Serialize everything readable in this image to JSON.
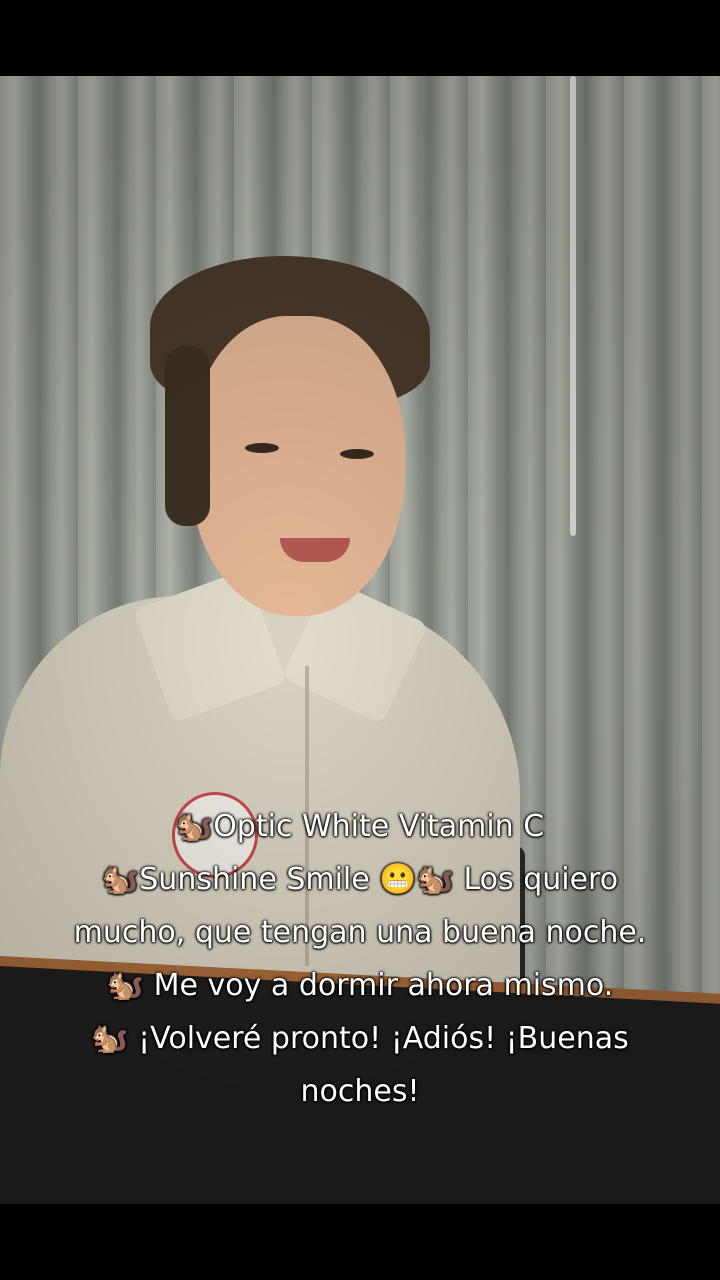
{
  "caption": {
    "lines": [
      "🐿️Optic White Vitamin C",
      "🐿️Sunshine Smile 😬🐿️ Los quiero",
      "mucho, que tengan una buena noche.",
      "🐿️ Me voy a dormir ahora mismo.",
      "🐿️ ¡Volveré pronto! ¡Adiós! ¡Buenas",
      "noches!"
    ]
  },
  "icons": {
    "squirrel": "squirrel-emoji-icon",
    "grimace": "grimacing-face-emoji-icon"
  },
  "colors": {
    "letterbox": "#000000",
    "caption_text": "#ffffff"
  }
}
